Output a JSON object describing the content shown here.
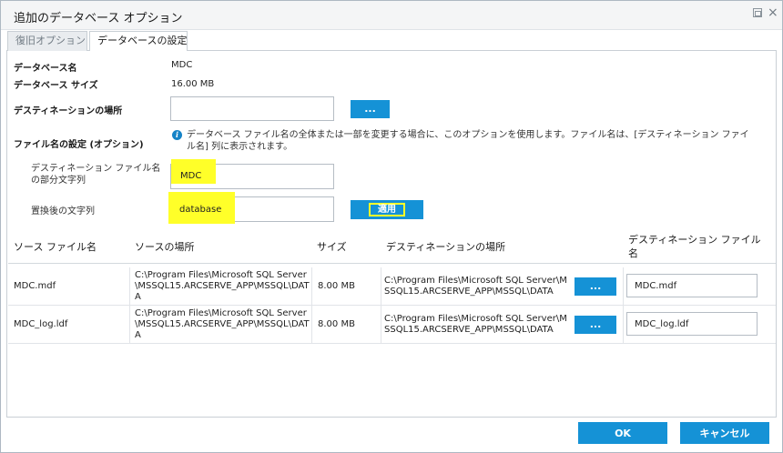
{
  "dialog": {
    "title": "追加のデータベース オプション"
  },
  "tabs": [
    {
      "label": "復旧オプション",
      "active": false
    },
    {
      "label": "データベースの設定",
      "active": true
    }
  ],
  "form": {
    "db_name_label": "データベース名",
    "db_name_value": "MDC",
    "db_size_label": "データベース サイズ",
    "db_size_value": "16.00 MB",
    "dest_location_label": "デスティネーションの場所",
    "dest_location_value": "",
    "browse_label": "...",
    "filename_setting_label": "ファイル名の設定 (オプション)",
    "filename_info": "データベース ファイル名の全体または一部を変更する場合に、このオプションを使用します。ファイル名は、[デスティネーション ファイル名] 列に表示されます。",
    "partial_string_label": "デスティネーション ファイル名の部分文字列",
    "partial_string_value": "MDC",
    "replacement_label": "置換後の文字列",
    "replacement_value": "database",
    "apply_label": "適用"
  },
  "table": {
    "columns": [
      "ソース ファイル名",
      "ソースの場所",
      "サイズ",
      "デスティネーションの場所",
      "デスティネーション ファイル名"
    ],
    "rows": [
      {
        "source_file": "MDC.mdf",
        "source_location": "C:\\Program Files\\Microsoft SQL Server\\MSSQL15.ARCSERVE_APP\\MSSQL\\DATA",
        "size": "8.00 MB",
        "destination_location": "C:\\Program Files\\Microsoft SQL Server\\MSSQL15.ARCSERVE_APP\\MSSQL\\DATA",
        "browse_label": "...",
        "destination_file": "MDC.mdf"
      },
      {
        "source_file": "MDC_log.ldf",
        "source_location": "C:\\Program Files\\Microsoft SQL Server\\MSSQL15.ARCSERVE_APP\\MSSQL\\DATA",
        "size": "8.00 MB",
        "destination_location": "C:\\Program Files\\Microsoft SQL Server\\MSSQL15.ARCSERVE_APP\\MSSQL\\DATA",
        "browse_label": "...",
        "destination_file": "MDC_log.ldf"
      }
    ]
  },
  "footer": {
    "ok_label": "OK",
    "cancel_label": "キャンセル"
  },
  "colors": {
    "accent": "#1592d6",
    "highlight": "#ffff29"
  },
  "icons": {
    "restore": "restore-icon",
    "close": "close-icon",
    "info": "info-icon"
  }
}
